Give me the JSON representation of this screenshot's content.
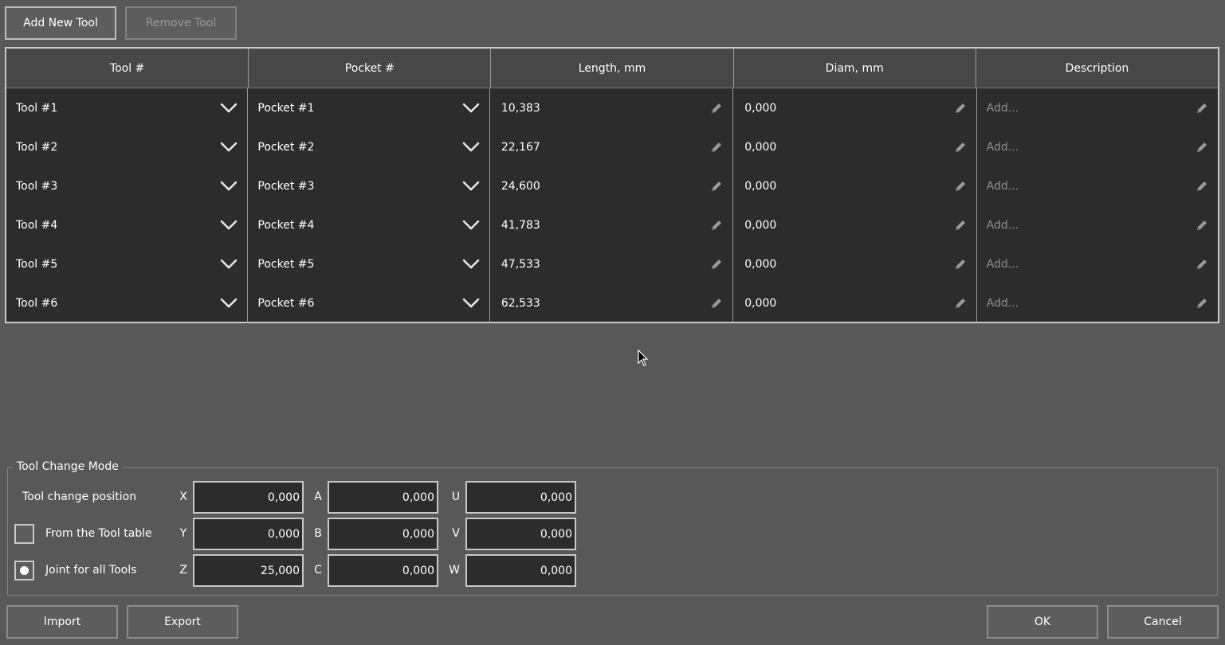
{
  "toolbar": {
    "add_label": "Add New Tool",
    "remove_label": "Remove Tool"
  },
  "table": {
    "headers": [
      "Tool #",
      "Pocket #",
      "Length, mm",
      "Diam, mm",
      "Description"
    ],
    "rows": [
      {
        "tool": "Tool #1",
        "pocket": "Pocket #1",
        "length": "10,383",
        "diam": "0,000",
        "description_placeholder": "Add..."
      },
      {
        "tool": "Tool #2",
        "pocket": "Pocket #2",
        "length": "22,167",
        "diam": "0,000",
        "description_placeholder": "Add..."
      },
      {
        "tool": "Tool #3",
        "pocket": "Pocket #3",
        "length": "24,600",
        "diam": "0,000",
        "description_placeholder": "Add..."
      },
      {
        "tool": "Tool #4",
        "pocket": "Pocket #4",
        "length": "41,783",
        "diam": "0,000",
        "description_placeholder": "Add..."
      },
      {
        "tool": "Tool #5",
        "pocket": "Pocket #5",
        "length": "47,533",
        "diam": "0,000",
        "description_placeholder": "Add..."
      },
      {
        "tool": "Tool #6",
        "pocket": "Pocket #6",
        "length": "62,533",
        "diam": "0,000",
        "description_placeholder": "Add..."
      }
    ],
    "row_icons": {
      "dropdown": "chevron-down-icon",
      "edit": "pencil-icon"
    }
  },
  "tool_change_mode": {
    "title": "Tool Change Mode",
    "position_label": "Tool change position",
    "from_table_label": "From the Tool table",
    "from_table_checked": false,
    "joint_label": "Joint for all Tools",
    "joint_selected": true,
    "axes": {
      "X": "0,000",
      "Y": "0,000",
      "Z": "25,000",
      "A": "0,000",
      "B": "0,000",
      "C": "0,000",
      "U": "0,000",
      "V": "0,000",
      "W": "0,000"
    },
    "axis_labels": {
      "X": "X",
      "Y": "Y",
      "Z": "Z",
      "A": "A",
      "B": "B",
      "C": "C",
      "U": "U",
      "V": "V",
      "W": "W"
    }
  },
  "footer": {
    "import_label": "Import",
    "export_label": "Export",
    "ok_label": "OK",
    "cancel_label": "Cancel"
  },
  "colors": {
    "background": "#585858",
    "table_bg": "#2c2c2c",
    "header_bg": "#474747",
    "border": "#c8c8c8",
    "placeholder": "#8e8e8e"
  }
}
